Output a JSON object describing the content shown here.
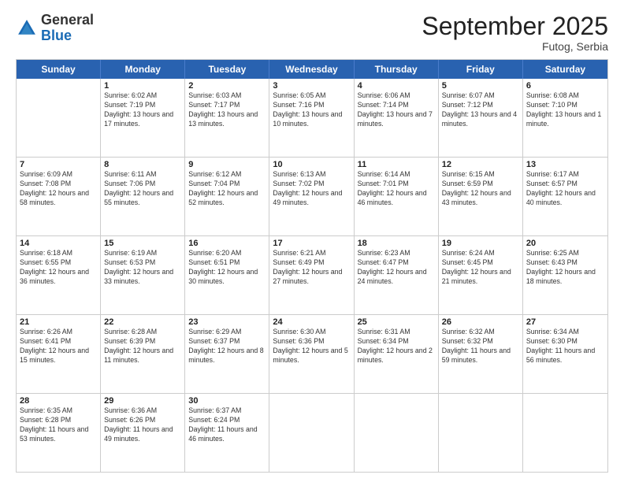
{
  "logo": {
    "general": "General",
    "blue": "Blue"
  },
  "header": {
    "title": "September 2025",
    "subtitle": "Futog, Serbia"
  },
  "days": [
    "Sunday",
    "Monday",
    "Tuesday",
    "Wednesday",
    "Thursday",
    "Friday",
    "Saturday"
  ],
  "weeks": [
    [
      {
        "num": "",
        "sunrise": "",
        "sunset": "",
        "daylight": ""
      },
      {
        "num": "1",
        "sunrise": "Sunrise: 6:02 AM",
        "sunset": "Sunset: 7:19 PM",
        "daylight": "Daylight: 13 hours and 17 minutes."
      },
      {
        "num": "2",
        "sunrise": "Sunrise: 6:03 AM",
        "sunset": "Sunset: 7:17 PM",
        "daylight": "Daylight: 13 hours and 13 minutes."
      },
      {
        "num": "3",
        "sunrise": "Sunrise: 6:05 AM",
        "sunset": "Sunset: 7:16 PM",
        "daylight": "Daylight: 13 hours and 10 minutes."
      },
      {
        "num": "4",
        "sunrise": "Sunrise: 6:06 AM",
        "sunset": "Sunset: 7:14 PM",
        "daylight": "Daylight: 13 hours and 7 minutes."
      },
      {
        "num": "5",
        "sunrise": "Sunrise: 6:07 AM",
        "sunset": "Sunset: 7:12 PM",
        "daylight": "Daylight: 13 hours and 4 minutes."
      },
      {
        "num": "6",
        "sunrise": "Sunrise: 6:08 AM",
        "sunset": "Sunset: 7:10 PM",
        "daylight": "Daylight: 13 hours and 1 minute."
      }
    ],
    [
      {
        "num": "7",
        "sunrise": "Sunrise: 6:09 AM",
        "sunset": "Sunset: 7:08 PM",
        "daylight": "Daylight: 12 hours and 58 minutes."
      },
      {
        "num": "8",
        "sunrise": "Sunrise: 6:11 AM",
        "sunset": "Sunset: 7:06 PM",
        "daylight": "Daylight: 12 hours and 55 minutes."
      },
      {
        "num": "9",
        "sunrise": "Sunrise: 6:12 AM",
        "sunset": "Sunset: 7:04 PM",
        "daylight": "Daylight: 12 hours and 52 minutes."
      },
      {
        "num": "10",
        "sunrise": "Sunrise: 6:13 AM",
        "sunset": "Sunset: 7:02 PM",
        "daylight": "Daylight: 12 hours and 49 minutes."
      },
      {
        "num": "11",
        "sunrise": "Sunrise: 6:14 AM",
        "sunset": "Sunset: 7:01 PM",
        "daylight": "Daylight: 12 hours and 46 minutes."
      },
      {
        "num": "12",
        "sunrise": "Sunrise: 6:15 AM",
        "sunset": "Sunset: 6:59 PM",
        "daylight": "Daylight: 12 hours and 43 minutes."
      },
      {
        "num": "13",
        "sunrise": "Sunrise: 6:17 AM",
        "sunset": "Sunset: 6:57 PM",
        "daylight": "Daylight: 12 hours and 40 minutes."
      }
    ],
    [
      {
        "num": "14",
        "sunrise": "Sunrise: 6:18 AM",
        "sunset": "Sunset: 6:55 PM",
        "daylight": "Daylight: 12 hours and 36 minutes."
      },
      {
        "num": "15",
        "sunrise": "Sunrise: 6:19 AM",
        "sunset": "Sunset: 6:53 PM",
        "daylight": "Daylight: 12 hours and 33 minutes."
      },
      {
        "num": "16",
        "sunrise": "Sunrise: 6:20 AM",
        "sunset": "Sunset: 6:51 PM",
        "daylight": "Daylight: 12 hours and 30 minutes."
      },
      {
        "num": "17",
        "sunrise": "Sunrise: 6:21 AM",
        "sunset": "Sunset: 6:49 PM",
        "daylight": "Daylight: 12 hours and 27 minutes."
      },
      {
        "num": "18",
        "sunrise": "Sunrise: 6:23 AM",
        "sunset": "Sunset: 6:47 PM",
        "daylight": "Daylight: 12 hours and 24 minutes."
      },
      {
        "num": "19",
        "sunrise": "Sunrise: 6:24 AM",
        "sunset": "Sunset: 6:45 PM",
        "daylight": "Daylight: 12 hours and 21 minutes."
      },
      {
        "num": "20",
        "sunrise": "Sunrise: 6:25 AM",
        "sunset": "Sunset: 6:43 PM",
        "daylight": "Daylight: 12 hours and 18 minutes."
      }
    ],
    [
      {
        "num": "21",
        "sunrise": "Sunrise: 6:26 AM",
        "sunset": "Sunset: 6:41 PM",
        "daylight": "Daylight: 12 hours and 15 minutes."
      },
      {
        "num": "22",
        "sunrise": "Sunrise: 6:28 AM",
        "sunset": "Sunset: 6:39 PM",
        "daylight": "Daylight: 12 hours and 11 minutes."
      },
      {
        "num": "23",
        "sunrise": "Sunrise: 6:29 AM",
        "sunset": "Sunset: 6:37 PM",
        "daylight": "Daylight: 12 hours and 8 minutes."
      },
      {
        "num": "24",
        "sunrise": "Sunrise: 6:30 AM",
        "sunset": "Sunset: 6:36 PM",
        "daylight": "Daylight: 12 hours and 5 minutes."
      },
      {
        "num": "25",
        "sunrise": "Sunrise: 6:31 AM",
        "sunset": "Sunset: 6:34 PM",
        "daylight": "Daylight: 12 hours and 2 minutes."
      },
      {
        "num": "26",
        "sunrise": "Sunrise: 6:32 AM",
        "sunset": "Sunset: 6:32 PM",
        "daylight": "Daylight: 11 hours and 59 minutes."
      },
      {
        "num": "27",
        "sunrise": "Sunrise: 6:34 AM",
        "sunset": "Sunset: 6:30 PM",
        "daylight": "Daylight: 11 hours and 56 minutes."
      }
    ],
    [
      {
        "num": "28",
        "sunrise": "Sunrise: 6:35 AM",
        "sunset": "Sunset: 6:28 PM",
        "daylight": "Daylight: 11 hours and 53 minutes."
      },
      {
        "num": "29",
        "sunrise": "Sunrise: 6:36 AM",
        "sunset": "Sunset: 6:26 PM",
        "daylight": "Daylight: 11 hours and 49 minutes."
      },
      {
        "num": "30",
        "sunrise": "Sunrise: 6:37 AM",
        "sunset": "Sunset: 6:24 PM",
        "daylight": "Daylight: 11 hours and 46 minutes."
      },
      {
        "num": "",
        "sunrise": "",
        "sunset": "",
        "daylight": ""
      },
      {
        "num": "",
        "sunrise": "",
        "sunset": "",
        "daylight": ""
      },
      {
        "num": "",
        "sunrise": "",
        "sunset": "",
        "daylight": ""
      },
      {
        "num": "",
        "sunrise": "",
        "sunset": "",
        "daylight": ""
      }
    ]
  ]
}
